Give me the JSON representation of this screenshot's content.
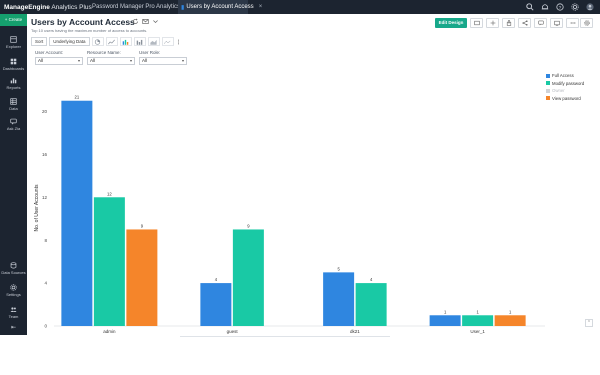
{
  "topbar": {
    "brand_main": "ManageEngine",
    "brand_sub": "Analytics Plus",
    "workspace": "Password Manager Pro Analytics",
    "tab_label": "Users by Account Access"
  },
  "sidebar": {
    "create_label": "+ Create",
    "items": [
      {
        "label": "Explorer",
        "icon": "explorer-icon"
      },
      {
        "label": "Dashboards",
        "icon": "dashboards-icon"
      },
      {
        "label": "Reports",
        "icon": "reports-icon"
      },
      {
        "label": "Data",
        "icon": "data-icon"
      },
      {
        "label": "Ask Zia",
        "icon": "ask-zia-icon"
      },
      {
        "label": "Data Sources",
        "icon": "data-sources-icon"
      },
      {
        "label": "Settings",
        "icon": "settings-icon"
      },
      {
        "label": "Team",
        "icon": "team-icon"
      }
    ]
  },
  "header": {
    "title": "Users by Account Access",
    "subtitle": "Top 10 users having the maximum number of access to accounts.",
    "edit_design": "Edit Design"
  },
  "toolbar": {
    "sort": "Sort",
    "underlying_data": "Underlying Data"
  },
  "filters": [
    {
      "label": "User Account:",
      "value": "All"
    },
    {
      "label": "Resource Name:",
      "value": "All"
    },
    {
      "label": "User Role:",
      "value": "All"
    }
  ],
  "colors": {
    "full_access": "#2f86e0",
    "modify_password": "#19c9a5",
    "owner": "#d0d3d7",
    "view_password": "#f5852a",
    "accent": "#17a88a"
  },
  "chart_data": {
    "type": "bar",
    "categories": [
      "admin",
      "guest",
      "dk21",
      "User_1"
    ],
    "series": [
      {
        "name": "Full Access",
        "values": [
          21,
          4,
          5,
          1
        ]
      },
      {
        "name": "Modify password",
        "values": [
          12,
          9,
          4,
          1
        ]
      },
      {
        "name": "Owner",
        "values": [
          0,
          0,
          0,
          0
        ]
      },
      {
        "name": "View password",
        "values": [
          9,
          0,
          0,
          1
        ]
      }
    ],
    "ylabel": "No. of User Accounts",
    "xlabel": "",
    "ylim": [
      0,
      22
    ],
    "yticks": [
      0,
      4,
      8,
      12,
      16,
      20
    ],
    "legend_position": "top-right",
    "grid": false
  }
}
